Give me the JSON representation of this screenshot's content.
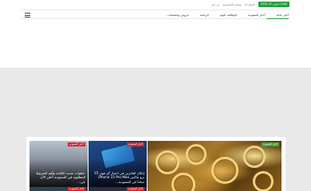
{
  "topbar": {
    "date": "الثلاثاء، فبراير 27، 2024",
    "links": [
      "الإعلان لنا",
      "سياسة الخصوصية",
      "من نحن"
    ]
  },
  "nav": {
    "items": [
      "أخبار عامة",
      "أخبار السعودية",
      "الوظائف اليوم",
      "الرياضة",
      "عروض وتخفيضات"
    ]
  },
  "featured": {
    "big": {
      "badge": "أخبار السعودية"
    },
    "middle": {
      "badge": "أخبار السعودية",
      "title": "إعلان الفائزين في اختبار آي فون 15 برو ماكس iPhone 15 Pro Max مجانا في السعودية..."
    },
    "left": {
      "badge": "أخبار السعودية",
      "title": "خطوات تجديد الإقامة وأهم الشروط المطلوبة في السعودية أعلن الآن عن..."
    },
    "bottom_badges": [
      "أخبار السعودية",
      "أخبار السعودية"
    ]
  }
}
